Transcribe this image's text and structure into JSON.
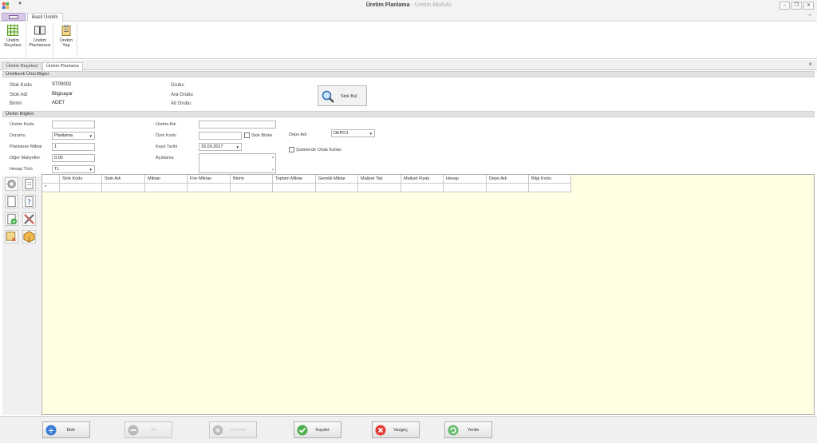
{
  "window": {
    "title": "Üretim Planlama",
    "subtitle": "- Üretim Modulü"
  },
  "ribbon": {
    "tab": "Basit Üretim",
    "buttons": [
      {
        "label1": "Üretim",
        "label2": "Reçetesi",
        "icon": "grid-icon"
      },
      {
        "label1": "Üretim",
        "label2": "Planlaması",
        "icon": "book-icon"
      },
      {
        "label1": "Üretim",
        "label2": "Yap",
        "icon": "clipboard-icon"
      }
    ]
  },
  "doc_tabs": [
    "Üretim Reçetesi",
    "Üretim Planlama"
  ],
  "product_info": {
    "header": "Üretilecek Ürün Bilgisi",
    "stok_kodu_label": "Stok Kodu",
    "stok_kodu": "ST00002",
    "stok_adi_label": "Stok Adi",
    "stok_adi": "Bilgisayar",
    "birimi_label": "Birimi",
    "birimi": "ADET",
    "grubu_label": "Grubu",
    "ara_grubu_label": "Ara Grubu",
    "alt_grubu_label": "Alt Grubu",
    "stok_bul": "Stok Bul"
  },
  "production_info": {
    "header": "Üretim Bilgileri",
    "uretim_kodu_label": "Üretim Kodu",
    "uretim_kodu": "",
    "durumu_label": "Durumu",
    "durumu": "Planlama",
    "planlanan_miktar_label": "Planlanan Miktar",
    "planlanan_miktar": "1",
    "diger_maliyetler_label": "Diğer Maliyetler",
    "diger_maliyetler": "0,00",
    "hesap_turu_label": "Hesap Türü",
    "hesap_turu": "TL",
    "uretim_adi_label": "Üretim Adı",
    "uretim_adi": "",
    "ozel_kodu_label": "Özel Kodu",
    "ozel_kodu": "",
    "stok_bloke_label": "Stok Bloke",
    "kayit_tarihi_label": "Kayıt Tarihi",
    "kayit_tarihi": "16.03.2017",
    "aciklama_label": "Açıklama",
    "depo_adi_label": "Depo Adı",
    "depo_adi": "DEPO1",
    "subelerde_label": "Şubelerde Ortak Kullan"
  },
  "grid": {
    "columns": [
      "",
      "Stok Kodu",
      "Stok Adı",
      "Miktarı",
      "Fire Miktarı",
      "Birimi",
      "Toplam Miktar",
      "Gerekli Miktar",
      "Maliyet Tipi",
      "Maliyet Fiyatı",
      "Hesap",
      "Depo Adı",
      "Bilgi Kodu"
    ],
    "new_row_marker": "*"
  },
  "bottom_buttons": {
    "ekle": "Ekle",
    "sil": "Sil",
    "duzenle": "Düzenle",
    "kaydet": "Kaydet",
    "vazgec": "Vazgeç",
    "yenile": "Yenile"
  },
  "colors": {
    "grid_bg": "#ffffe3",
    "accent_purple": "#d8c8e8",
    "kaydet_green": "#4caf50",
    "vazgec_red": "#e53935",
    "ekle_blue": "#3a7bd5"
  }
}
